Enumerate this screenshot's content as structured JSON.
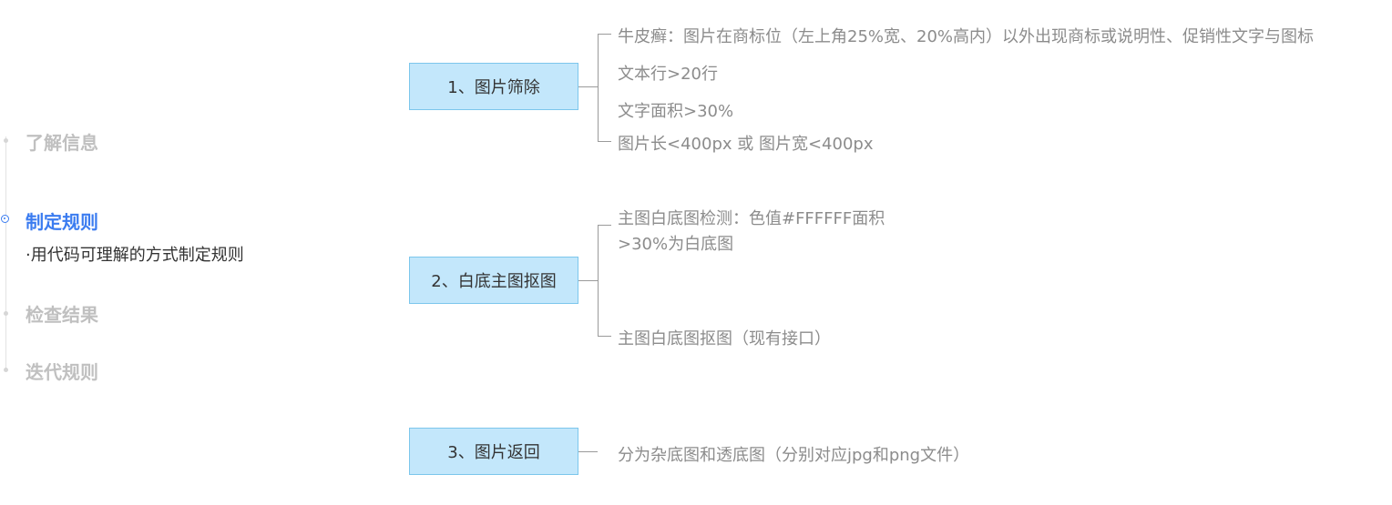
{
  "steps": [
    {
      "label": "了解信息",
      "state": "inactive"
    },
    {
      "label": "制定规则",
      "state": "active",
      "description": "·用代码可理解的方式制定规则"
    },
    {
      "label": "检查结果",
      "state": "inactive"
    },
    {
      "label": "迭代规则",
      "state": "inactive"
    }
  ],
  "nodes": [
    {
      "label": "1、图片筛除",
      "children": [
        "牛皮癣：图片在商标位（左上角25%宽、20%高内）以外出现商标或说明性、促销性文字与图标",
        "文本行>20行",
        "文字面积>30%",
        "图片长<400px 或 图片宽<400px"
      ]
    },
    {
      "label": "2、白底主图抠图",
      "children": [
        "主图白底图检测：色值#FFFFFF面积>30%为白底图",
        "主图白底图抠图（现有接口）"
      ]
    },
    {
      "label": "3、图片返回",
      "children": [
        "分为杂底图和透底图（分别对应jpg和png文件）"
      ]
    }
  ],
  "colors": {
    "accent": "#3b7cf0",
    "node_fill": "#c3e7fb",
    "node_border": "#7cc6ec",
    "connector": "#9a9a9a",
    "leaf_text": "#8c8c8c",
    "inactive_step": "#c0c0c0"
  }
}
